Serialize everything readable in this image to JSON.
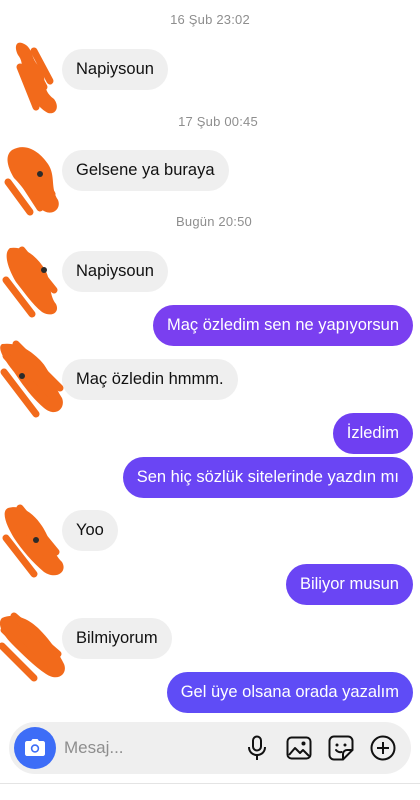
{
  "thread": {
    "timestamps": [
      "16 Şub 23:02",
      "17 Şub 00:45",
      "Bugün 20:50"
    ],
    "messages": [
      {
        "side": "in",
        "text": "Napiysoun"
      },
      {
        "side": "in",
        "text": "Gelsene ya buraya"
      },
      {
        "side": "in",
        "text": "Napiysoun"
      },
      {
        "side": "out",
        "text": "Maç özledim sen ne yapıyorsun"
      },
      {
        "side": "in",
        "text": "Maç özledin hmmm."
      },
      {
        "side": "out",
        "text": "İzledim"
      },
      {
        "side": "out",
        "text": "Sen hiç sözlük sitelerinde yazdın mı"
      },
      {
        "side": "in",
        "text": "Yoo"
      },
      {
        "side": "out",
        "text": "Biliyor musun"
      },
      {
        "side": "in",
        "text": "Bilmiyorum"
      },
      {
        "side": "out",
        "text": "Gel üye olsana orada yazalım"
      }
    ]
  },
  "composer": {
    "placeholder": "Mesaj...",
    "value": "",
    "icons": [
      "camera-icon",
      "microphone-icon",
      "gallery-icon",
      "sticker-icon",
      "add-icon"
    ]
  },
  "colors": {
    "outgoing_bubble": "#7a3ff0",
    "incoming_bubble": "#efefef",
    "camera_button": "#3d6df7",
    "timestamp_text": "#8e8e8e"
  }
}
